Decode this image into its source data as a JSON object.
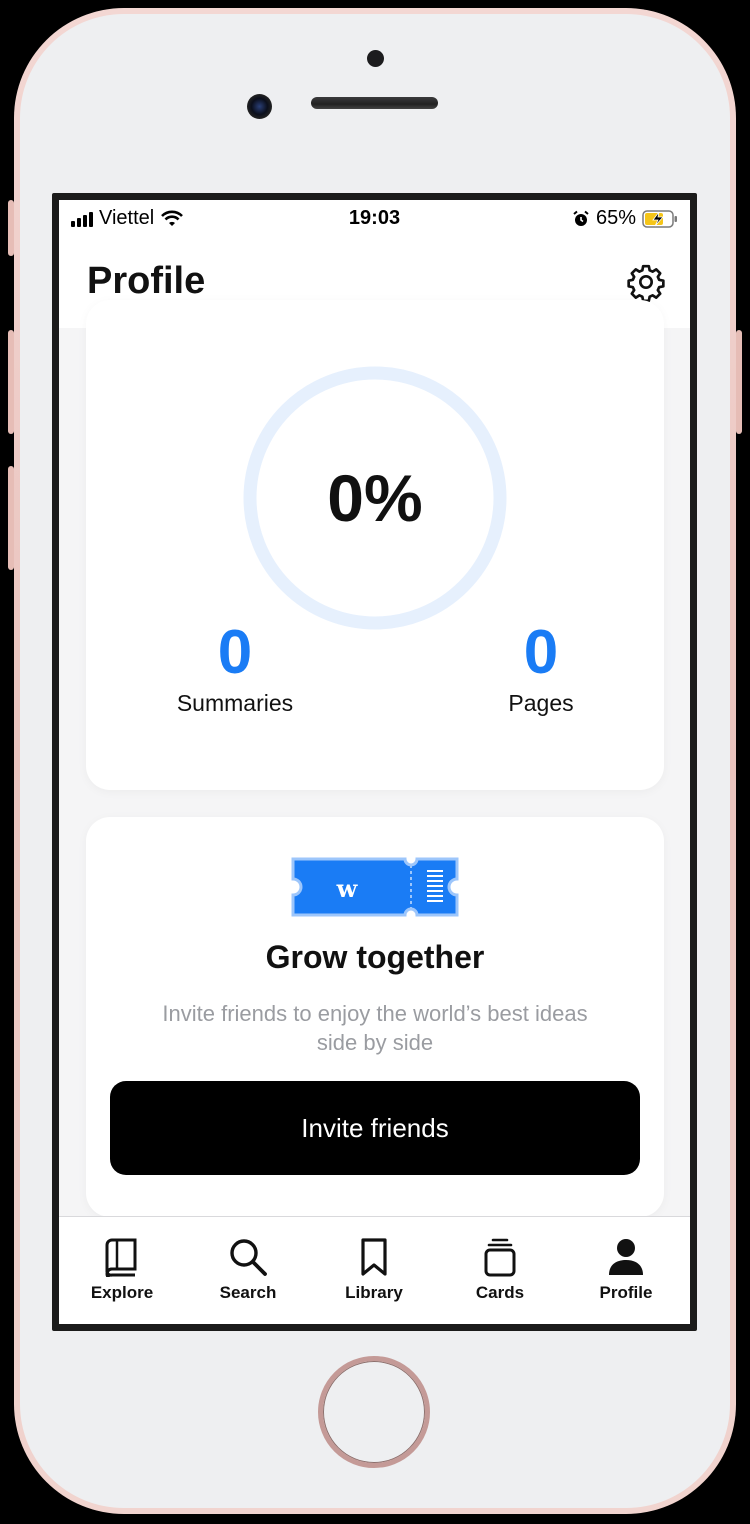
{
  "status_bar": {
    "carrier": "Viettel",
    "time": "19:03",
    "battery_percent": "65%"
  },
  "header": {
    "title": "Profile",
    "settings_icon": "gear-icon"
  },
  "progress_card": {
    "percent_label": "0%",
    "progress_fraction": 0,
    "ring_color": "#e6f0fd",
    "stats": [
      {
        "value": "0",
        "label": "Summaries"
      },
      {
        "value": "0",
        "label": "Pages"
      }
    ],
    "accent_color": "#1a7cf5"
  },
  "invite_card": {
    "icon": "ticket-icon",
    "title": "Grow together",
    "subtitle_line1": "Invite friends to enjoy the world’s best ideas",
    "subtitle_line2": "side by side",
    "button_label": "Invite friends"
  },
  "tab_bar": {
    "tabs": [
      {
        "label": "Explore",
        "icon": "book-icon"
      },
      {
        "label": "Search",
        "icon": "search-icon"
      },
      {
        "label": "Library",
        "icon": "bookmark-icon"
      },
      {
        "label": "Cards",
        "icon": "cards-icon"
      },
      {
        "label": "Profile",
        "icon": "person-icon",
        "active": true
      }
    ]
  }
}
